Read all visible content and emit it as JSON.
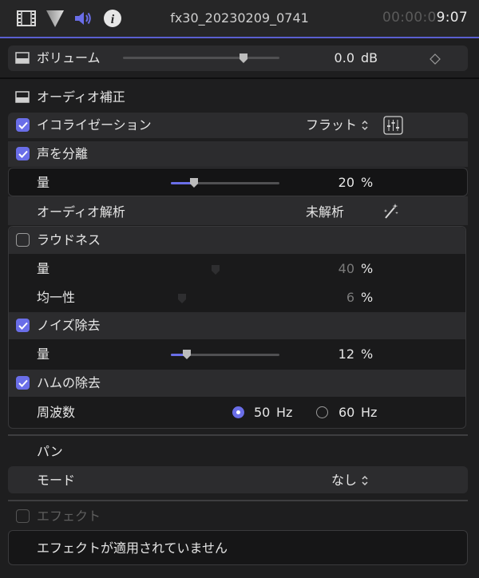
{
  "header": {
    "clip_name": "fx30_20230209_0741",
    "timecode_dim": "00:00:0",
    "timecode_bright": "9:07",
    "icons": [
      "film-icon",
      "video-triangle-icon",
      "speaker-icon",
      "info-icon"
    ]
  },
  "volume": {
    "label": "ボリューム",
    "value": "0.0",
    "unit": "dB",
    "slider_fraction": 0.77
  },
  "audio_enhance": {
    "title": "オーディオ補正",
    "equalization": {
      "label": "イコライゼーション",
      "value": "フラット",
      "checked": true
    },
    "voice_isolation": {
      "label": "声を分離",
      "checked": true,
      "amount_label": "量",
      "amount_value": "20",
      "unit": "%",
      "fraction": 0.2
    },
    "analysis": {
      "label": "オーディオ解析",
      "status": "未解析"
    },
    "loudness": {
      "label": "ラウドネス",
      "checked": false,
      "amount_label": "量",
      "amount_value": "40",
      "amount_fraction": 0.4,
      "uniformity_label": "均一性",
      "uniformity_value": "6",
      "uniformity_fraction": 0.06,
      "unit": "%"
    },
    "noise_removal": {
      "label": "ノイズ除去",
      "checked": true,
      "amount_label": "量",
      "amount_value": "12",
      "unit": "%",
      "fraction": 0.12
    },
    "hum_removal": {
      "label": "ハムの除去",
      "checked": true,
      "frequency_label": "周波数",
      "options": [
        {
          "value": "50",
          "unit": "Hz",
          "selected": true
        },
        {
          "value": "60",
          "unit": "Hz",
          "selected": false
        }
      ]
    }
  },
  "pan": {
    "title": "パン",
    "mode_label": "モード",
    "mode_value": "なし"
  },
  "effects": {
    "label": "エフェクト",
    "checked": false,
    "empty_message": "エフェクトが適用されていません"
  },
  "colors": {
    "accent": "#6a6ee8",
    "background": "#1e1e1f",
    "row": "#2c2c2e"
  }
}
